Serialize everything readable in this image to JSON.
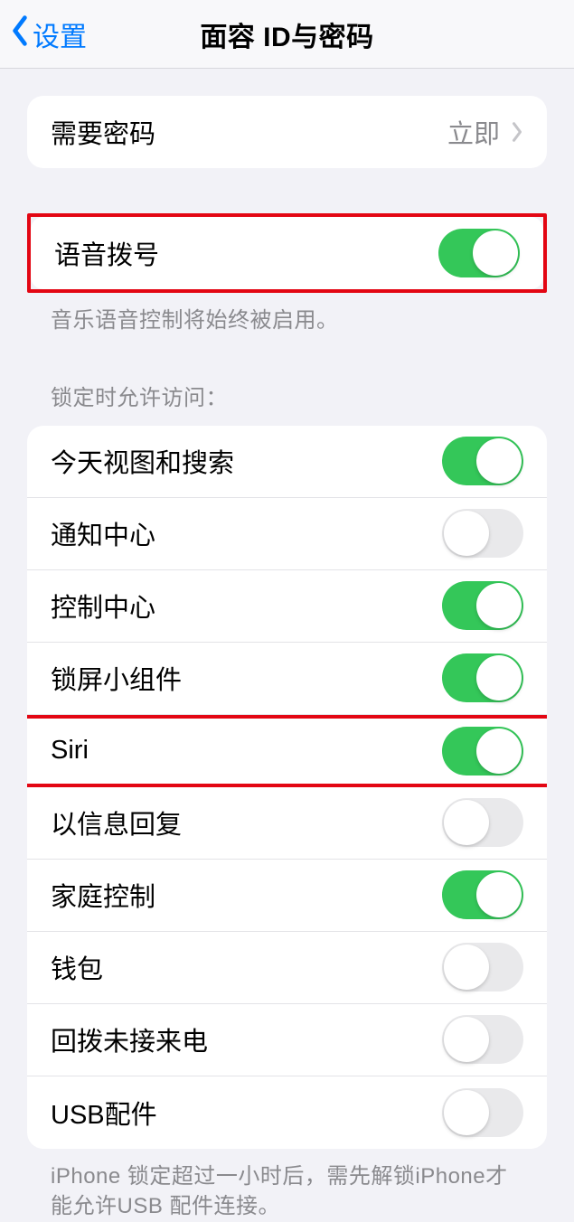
{
  "nav": {
    "back": "设置",
    "title": "面容 ID与密码"
  },
  "passcode": {
    "label": "需要密码",
    "value": "立即"
  },
  "voicedial": {
    "label": "语音拨号",
    "on": true,
    "footer": "音乐语音控制将始终被启用。"
  },
  "lockaccess": {
    "header": "锁定时允许访问：",
    "items": [
      {
        "label": "今天视图和搜索",
        "on": true
      },
      {
        "label": "通知中心",
        "on": false
      },
      {
        "label": "控制中心",
        "on": true
      },
      {
        "label": "锁屏小组件",
        "on": true
      },
      {
        "label": "Siri",
        "on": true,
        "highlight": true
      },
      {
        "label": "以信息回复",
        "on": false
      },
      {
        "label": "家庭控制",
        "on": true
      },
      {
        "label": "钱包",
        "on": false
      },
      {
        "label": "回拨未接来电",
        "on": false
      },
      {
        "label": "USB配件",
        "on": false
      }
    ],
    "footer": "iPhone 锁定超过一小时后，需先解锁iPhone才能允许USB 配件连接。"
  }
}
